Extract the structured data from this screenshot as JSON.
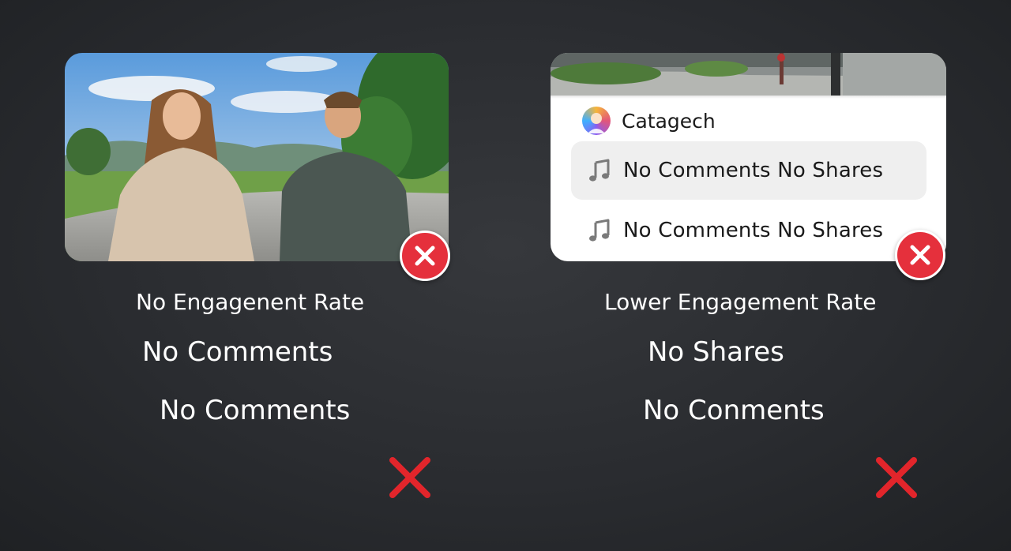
{
  "left_panel": {
    "heading": "No Engagenent Rate",
    "line1": "No Comments",
    "line2": "No Comments",
    "photo_icon": "two-people-outdoor-photo",
    "close_icon": "close-icon"
  },
  "right_panel": {
    "account_name": "Catagech",
    "sounds": [
      {
        "label": "No Comments No Shares",
        "icon": "music-note-icon"
      },
      {
        "label": "No Comments No Shares",
        "icon": "music-note-icon"
      }
    ],
    "heading": "Lower Engagement Rate",
    "line1": "No Shares",
    "line2": "No Conments",
    "close_icon": "close-icon"
  },
  "colors": {
    "background": "#2a2c30",
    "badge_red": "#e5303c",
    "x_red": "#e2252b",
    "card_white": "#ffffff"
  }
}
